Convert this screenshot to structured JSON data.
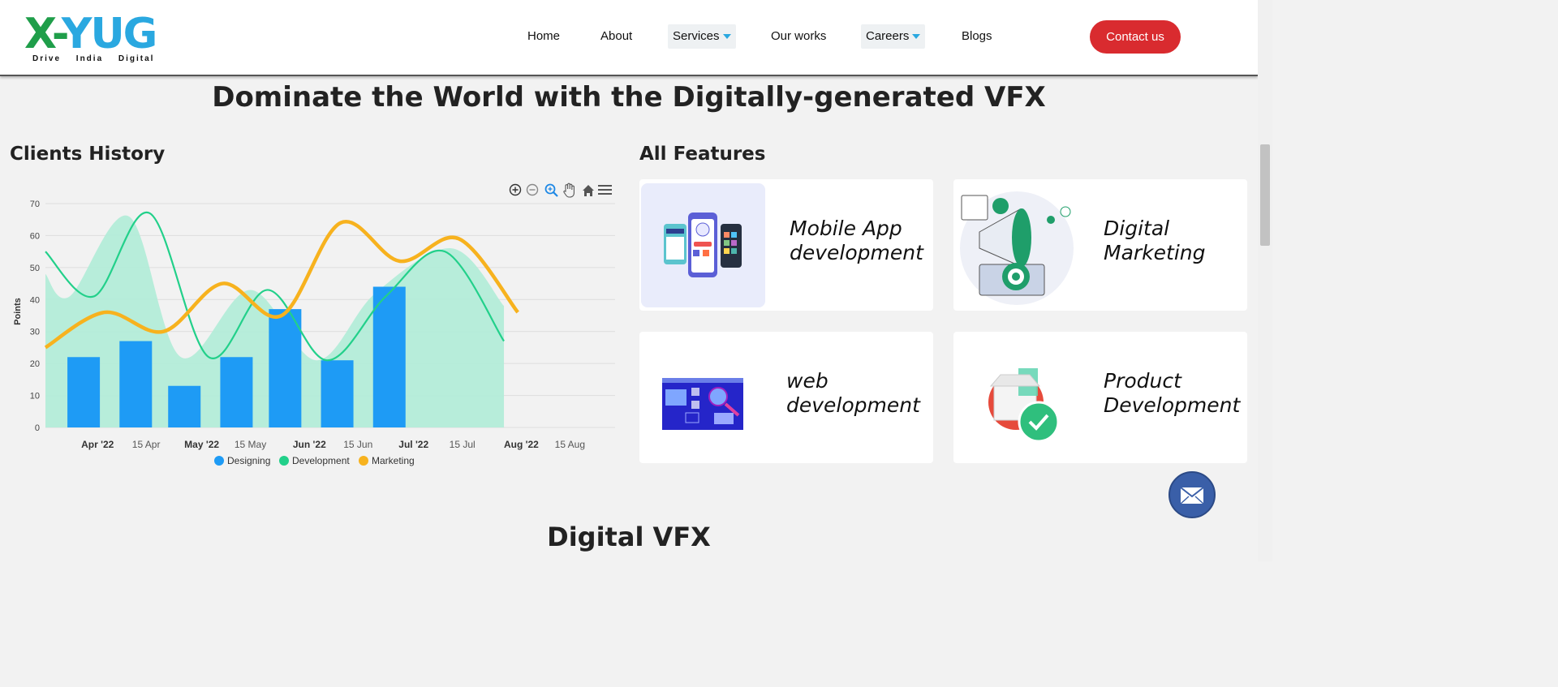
{
  "header": {
    "logo": {
      "text_x": "X-",
      "text_rest": "YUG",
      "tagline": "Drive India Digital"
    },
    "nav": [
      {
        "label": "Home",
        "dropdown": false
      },
      {
        "label": "About",
        "dropdown": false
      },
      {
        "label": "Services",
        "dropdown": true
      },
      {
        "label": "Our works",
        "dropdown": false
      },
      {
        "label": "Careers",
        "dropdown": true
      },
      {
        "label": "Blogs",
        "dropdown": false
      }
    ],
    "contact_label": "Contact us"
  },
  "main_title": "Dominate the World with the Digitally-generated VFX",
  "clients_history": {
    "title": "Clients History",
    "toolbar": [
      "zoom-in-icon",
      "zoom-out-icon",
      "selection-zoom-icon",
      "pan-hand-icon",
      "reset-home-icon",
      "menu-icon"
    ]
  },
  "chart_data": {
    "type": "line",
    "title": "",
    "xlabel": "",
    "ylabel": "Points",
    "ylim": [
      0,
      70
    ],
    "yticks": [
      0,
      10,
      20,
      30,
      40,
      50,
      60,
      70
    ],
    "grid": true,
    "legend_position": "bottom",
    "x_tick_labels": [
      {
        "date": "2022-04-01",
        "label": "Apr '22",
        "bold": true
      },
      {
        "date": "2022-04-15",
        "label": "15 Apr",
        "bold": false
      },
      {
        "date": "2022-05-01",
        "label": "May '22",
        "bold": true
      },
      {
        "date": "2022-05-15",
        "label": "15 May",
        "bold": false
      },
      {
        "date": "2022-06-01",
        "label": "Jun '22",
        "bold": true
      },
      {
        "date": "2022-06-15",
        "label": "15 Jun",
        "bold": false
      },
      {
        "date": "2022-07-01",
        "label": "Jul '22",
        "bold": true
      },
      {
        "date": "2022-07-15",
        "label": "15 Jul",
        "bold": false
      },
      {
        "date": "2022-08-01",
        "label": "Aug '22",
        "bold": true
      },
      {
        "date": "2022-08-15",
        "label": "15 Aug",
        "bold": false
      }
    ],
    "x_range": [
      "2022-03-17",
      "2022-08-28"
    ],
    "series": [
      {
        "name": "Designing",
        "kind": "bar",
        "color": "#1e9bf5",
        "points": [
          {
            "x": "2022-03-28",
            "y": 22
          },
          {
            "x": "2022-04-12",
            "y": 27
          },
          {
            "x": "2022-04-26",
            "y": 13
          },
          {
            "x": "2022-05-11",
            "y": 22
          },
          {
            "x": "2022-05-25",
            "y": 37
          },
          {
            "x": "2022-06-09",
            "y": 21
          },
          {
            "x": "2022-06-24",
            "y": 44
          }
        ]
      },
      {
        "name": "Development",
        "kind": "area",
        "color": "#b3ecd8",
        "points": [
          {
            "x": "2022-03-17",
            "y": 48
          },
          {
            "x": "2022-03-24",
            "y": 41
          },
          {
            "x": "2022-04-10",
            "y": 66
          },
          {
            "x": "2022-04-25",
            "y": 22
          },
          {
            "x": "2022-05-15",
            "y": 43
          },
          {
            "x": "2022-06-03",
            "y": 21
          },
          {
            "x": "2022-06-20",
            "y": 42
          },
          {
            "x": "2022-07-12",
            "y": 56
          },
          {
            "x": "2022-07-27",
            "y": 38
          }
        ]
      },
      {
        "name": "Development",
        "kind": "line",
        "color": "#22d08a",
        "points": [
          {
            "x": "2022-03-17",
            "y": 55
          },
          {
            "x": "2022-03-31",
            "y": 41
          },
          {
            "x": "2022-04-16",
            "y": 67
          },
          {
            "x": "2022-05-03",
            "y": 22
          },
          {
            "x": "2022-05-20",
            "y": 43
          },
          {
            "x": "2022-06-06",
            "y": 21
          },
          {
            "x": "2022-06-23",
            "y": 41
          },
          {
            "x": "2022-07-10",
            "y": 55
          },
          {
            "x": "2022-07-27",
            "y": 27
          }
        ]
      },
      {
        "name": "Marketing",
        "kind": "line",
        "color": "#f7b21e",
        "points": [
          {
            "x": "2022-03-17",
            "y": 25
          },
          {
            "x": "2022-04-03",
            "y": 36
          },
          {
            "x": "2022-04-20",
            "y": 30
          },
          {
            "x": "2022-05-07",
            "y": 45
          },
          {
            "x": "2022-05-24",
            "y": 35
          },
          {
            "x": "2022-06-10",
            "y": 64
          },
          {
            "x": "2022-06-27",
            "y": 52
          },
          {
            "x": "2022-07-14",
            "y": 59
          },
          {
            "x": "2022-07-31",
            "y": 36
          }
        ]
      }
    ],
    "legend": [
      {
        "name": "Designing",
        "color": "#1e9bf5"
      },
      {
        "name": "Development",
        "color": "#22d08a"
      },
      {
        "name": "Marketing",
        "color": "#f7b21e"
      }
    ]
  },
  "features": {
    "title": "All Features",
    "cards": [
      {
        "label": "Mobile App development",
        "icon": "mobile-app-illustration"
      },
      {
        "label": "Digital Marketing",
        "icon": "megaphone-illustration"
      },
      {
        "label": "web development",
        "icon": "web-dev-illustration"
      },
      {
        "label": "Product Development",
        "icon": "product-box-illustration"
      }
    ]
  },
  "floating": {
    "icon": "mail-icon"
  },
  "bottom_title": "Digital VFX"
}
